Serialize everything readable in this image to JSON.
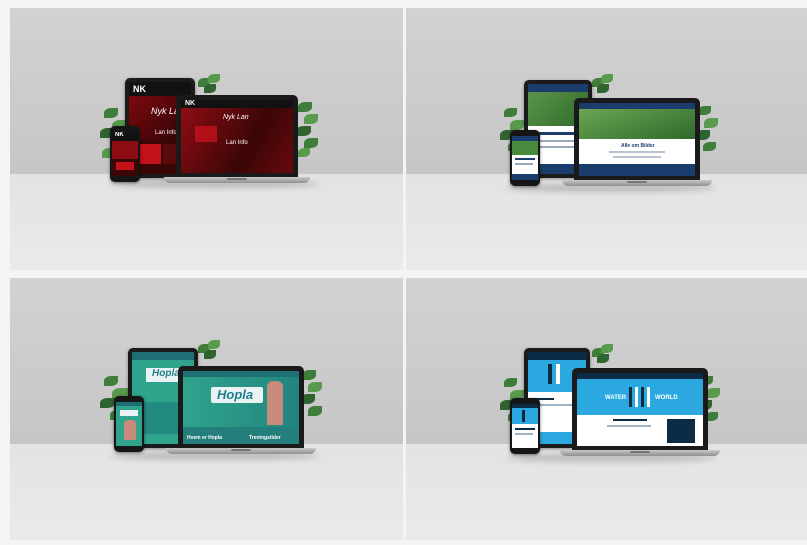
{
  "mockups": [
    {
      "id": "nyk",
      "colors": {
        "screen": "#3a0606",
        "accent": "#c3121c",
        "bar": "#111111",
        "text": "#ffffff"
      },
      "logo": "NK",
      "headline": "Nyk Lan",
      "subheadline": "Lan Info"
    },
    {
      "id": "nature",
      "colors": {
        "screen": "#ffffff",
        "bar": "#1b3d6e",
        "photo": "#3f7b35",
        "text": "#1b3d6e"
      },
      "heading": "Alle om Bilder"
    },
    {
      "id": "hopla",
      "colors": {
        "screen": "#2fa38c",
        "bar": "#ffffff",
        "banner": "#e9f3f3",
        "title": "#1f7f8a"
      },
      "title": "Hopla",
      "laptop_title": "Hopla",
      "links": [
        "Hvem er Hopla",
        "Treningstider"
      ]
    },
    {
      "id": "water",
      "colors": {
        "screen": "#2ba8e0",
        "bar": "#0c2b45",
        "white": "#ffffff"
      },
      "words": [
        "WATER",
        "WORLD"
      ]
    }
  ]
}
